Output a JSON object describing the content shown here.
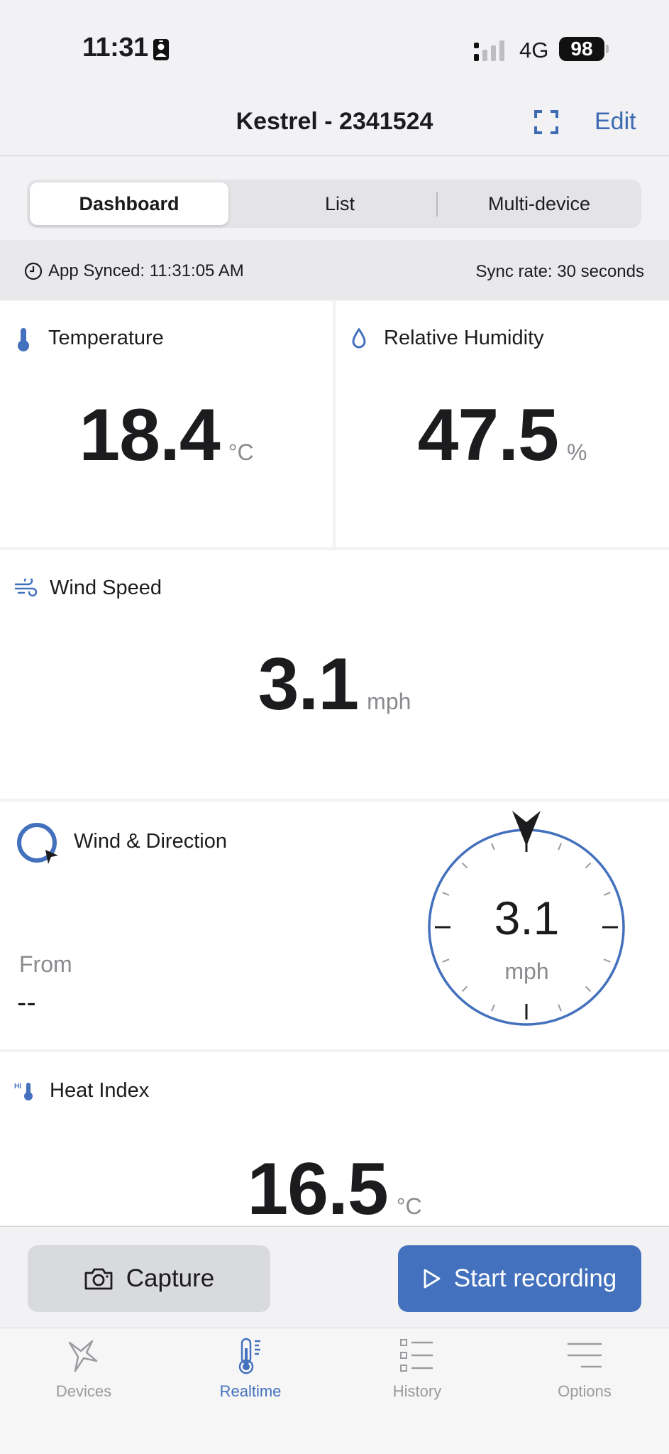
{
  "status_bar": {
    "time": "11:31",
    "network": "4G",
    "battery": "98"
  },
  "nav": {
    "title": "Kestrel - 2341524",
    "edit_label": "Edit"
  },
  "segments": {
    "items": [
      "Dashboard",
      "List",
      "Multi-device"
    ],
    "selected": "Dashboard"
  },
  "sync": {
    "app_synced": "App Synced: 11:31:05 AM",
    "sync_rate": "Sync rate: 30 seconds"
  },
  "tiles": {
    "temperature": {
      "label": "Temperature",
      "value": "18.4",
      "unit": "°C",
      "icon": "thermometer-icon"
    },
    "humidity": {
      "label": "Relative Humidity",
      "value": "47.5",
      "unit": "%",
      "icon": "droplet-icon"
    },
    "wind_speed": {
      "label": "Wind Speed",
      "value": "3.1",
      "unit": "mph",
      "icon": "wind-icon"
    },
    "wind_direction": {
      "label": "Wind & Direction",
      "from_label": "From",
      "from_value": "--",
      "speed": "3.1",
      "unit": "mph",
      "icon": "compass-ring-icon"
    },
    "heat_index": {
      "label": "Heat Index",
      "value": "16.5",
      "unit": "°C",
      "icon": "heat-index-icon"
    }
  },
  "actions": {
    "capture_label": "Capture",
    "record_label": "Start recording"
  },
  "tabbar": {
    "items": [
      {
        "label": "Devices",
        "icon": "bird-icon"
      },
      {
        "label": "Realtime",
        "icon": "thermometer-icon"
      },
      {
        "label": "History",
        "icon": "list-icon"
      },
      {
        "label": "Options",
        "icon": "menu-icon"
      }
    ],
    "selected": "Realtime"
  },
  "colors": {
    "accent": "#4471bd",
    "background": "#f2f2f4",
    "tile": "#ffffff"
  }
}
